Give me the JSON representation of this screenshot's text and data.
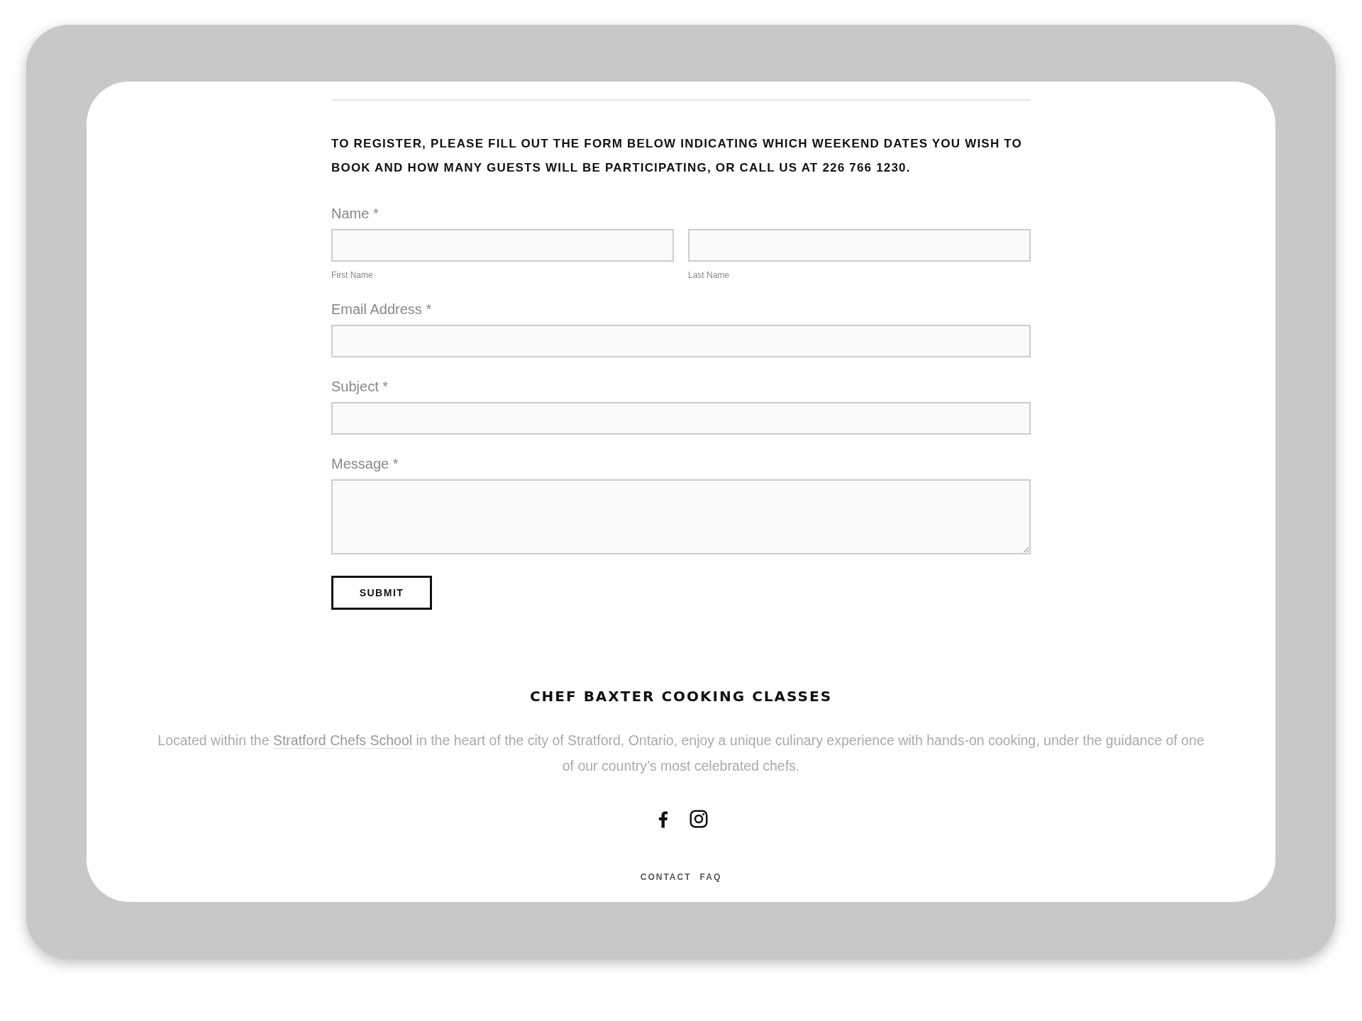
{
  "intro": "TO REGISTER, PLEASE FILL OUT THE FORM BELOW INDICATING WHICH WEEKEND DATES YOU WISH TO BOOK AND HOW MANY GUESTS WILL BE PARTICIPATING, OR CALL US AT 226 766 1230.",
  "fields": [
    {
      "kind": "name",
      "label": "Name *",
      "parts": [
        {
          "caption": "First Name"
        },
        {
          "caption": "Last Name"
        }
      ]
    },
    {
      "kind": "text",
      "label": "Email Address *"
    },
    {
      "kind": "text",
      "label": "Subject *"
    },
    {
      "kind": "textarea",
      "label": "Message *"
    }
  ],
  "submit": "SUBMIT",
  "footer": {
    "title": "CHEF BAXTER COOKING CLASSES",
    "text_before": "Located within the",
    "link": "Stratford Chefs School",
    "text_after": "in the heart of the city of Stratford, Ontario, enjoy a unique culinary experience with hands-on cooking, under the guidance of one of our country’s most celebrated chefs.",
    "social": [
      {
        "kind": "facebook"
      },
      {
        "kind": "instagram"
      }
    ],
    "links": [
      "CONTACT",
      "FAQ"
    ]
  }
}
